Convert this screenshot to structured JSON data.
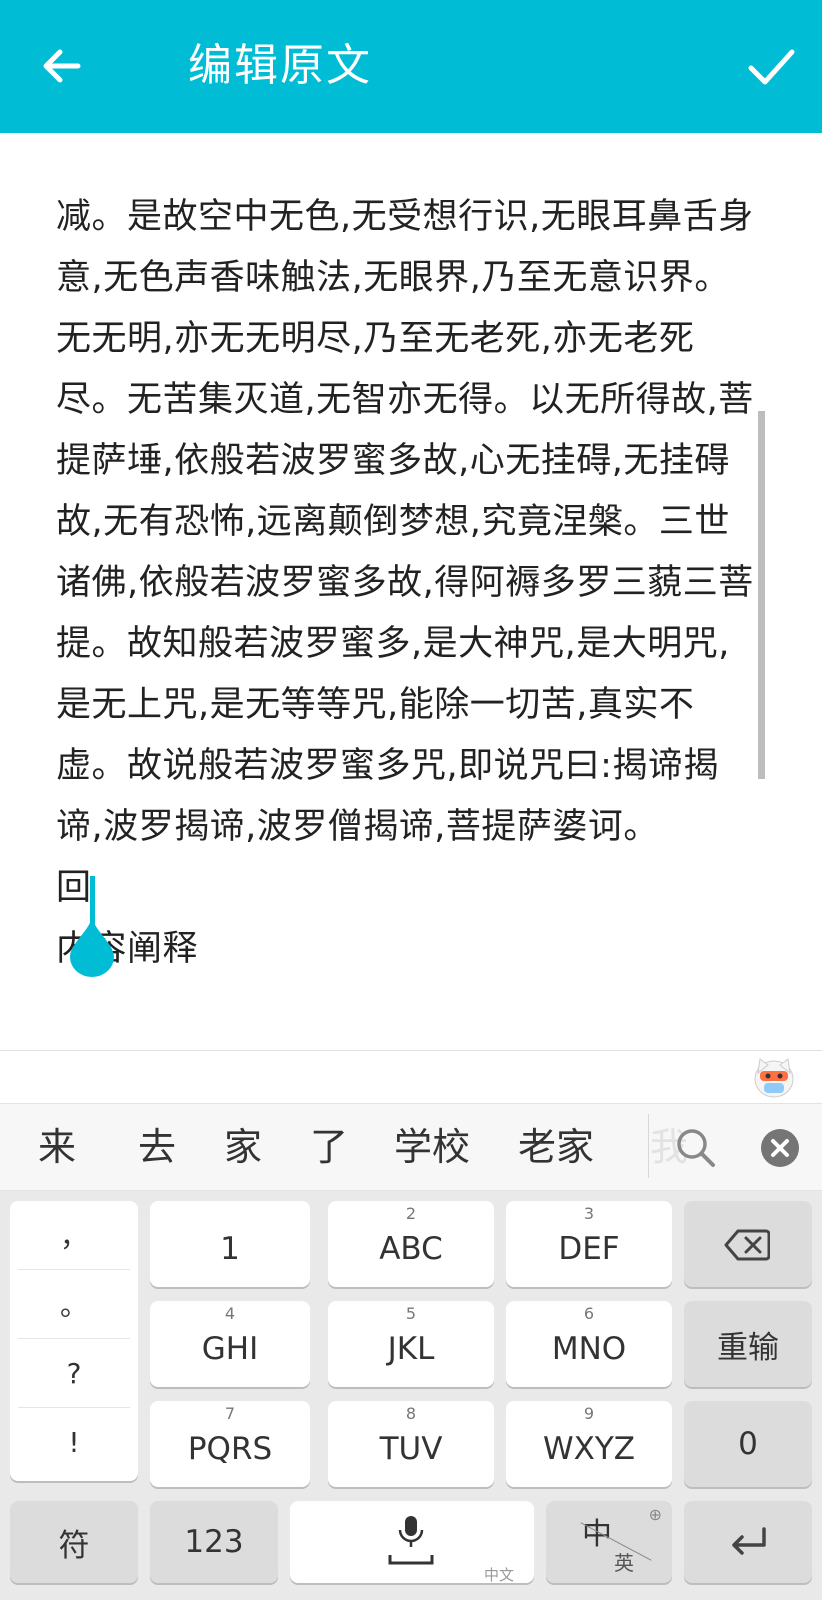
{
  "header": {
    "title": "编辑原文",
    "back_icon": "arrow-left-icon",
    "confirm_icon": "check-icon",
    "color": "#00BCD4"
  },
  "editor": {
    "lines": [
      "减。是故空中无色,无受想行识,无眼耳鼻舌身",
      "意,无色声香味触法,无眼界,乃至无意识界。",
      "无无明,亦无无明尽,乃至无老死,亦无老死",
      "尽。无苦集灭道,无智亦无得。以无所得故,菩",
      "提萨埵,依般若波罗蜜多故,心无挂碍,无挂碍",
      "故,无有恐怖,远离颠倒梦想,究竟涅槃。三世",
      "诸佛,依般若波罗蜜多故,得阿褥多罗三藐三菩",
      "提。故知般若波罗蜜多,是大神咒,是大明咒,",
      "是无上咒,是无等等咒,能除一切苦,真实不",
      "虚。故说般若波罗蜜多咒,即说咒曰:揭谛揭",
      "谛,波罗揭谛,波罗僧揭谛,菩提萨婆诃。",
      "回",
      "内容阐释"
    ]
  },
  "candidates": {
    "items": [
      "来",
      "去",
      "家",
      "了",
      "学校",
      "老家"
    ],
    "ghost": "我",
    "search_icon": "search-icon",
    "clear_icon": "clear-icon"
  },
  "keyboard": {
    "punctuation": [
      "，",
      "。",
      "?",
      "!"
    ],
    "rows": [
      {
        "num": "",
        "label": "1"
      },
      {
        "num": "2",
        "label": "ABC"
      },
      {
        "num": "3",
        "label": "DEF"
      },
      {
        "num": "4",
        "label": "GHI"
      },
      {
        "num": "5",
        "label": "JKL"
      },
      {
        "num": "6",
        "label": "MNO"
      },
      {
        "num": "7",
        "label": "PQRS"
      },
      {
        "num": "8",
        "label": "TUV"
      },
      {
        "num": "9",
        "label": "WXYZ"
      }
    ],
    "backspace_icon": "backspace-icon",
    "retype": "重输",
    "zero": "0",
    "symbols": "符",
    "numbers": "123",
    "mic_icon": "microphone-icon",
    "space_sub": "中文",
    "lang_zh": "中",
    "lang_en": "英",
    "enter_icon": "enter-icon"
  }
}
